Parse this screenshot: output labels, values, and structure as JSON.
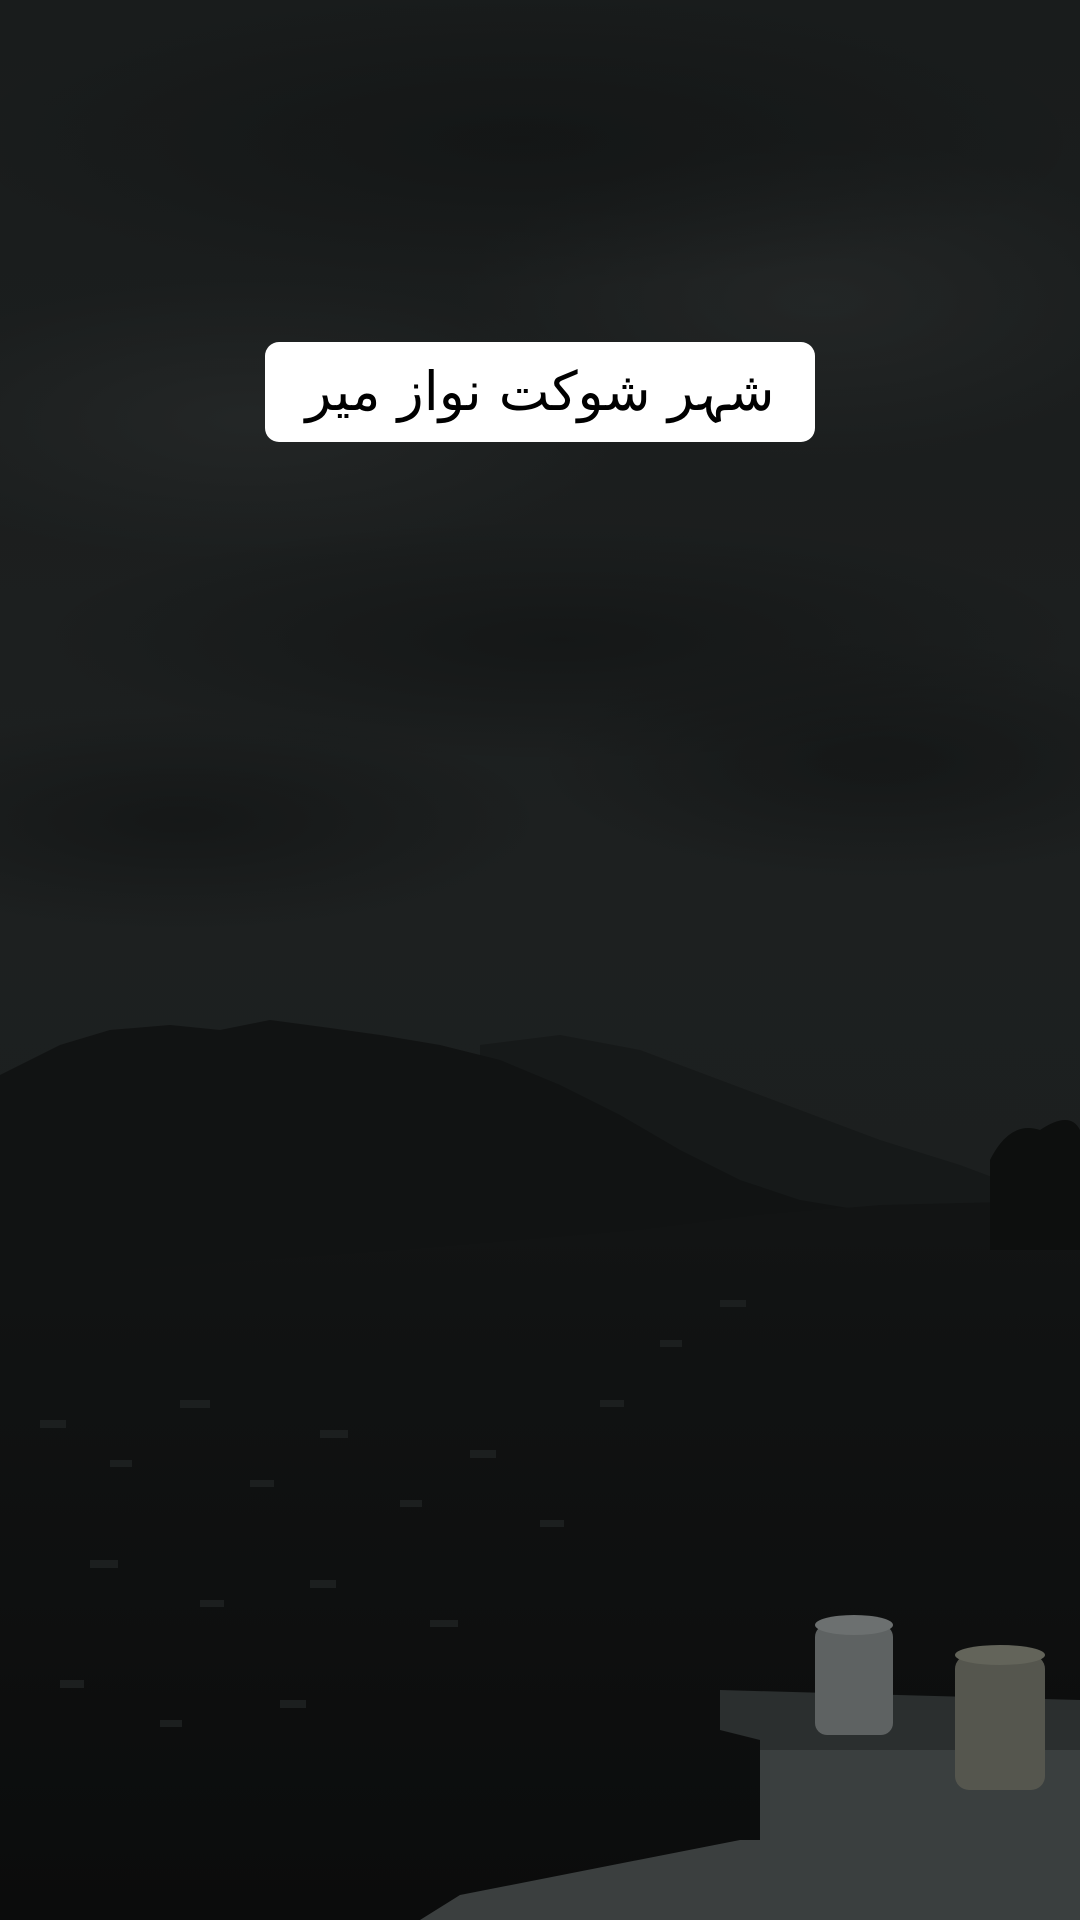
{
  "overlay": {
    "caption_text": "شہر شوکت نواز میر"
  },
  "background": {
    "scene": "dark overcast sky over mountains and a hillside town at dusk",
    "sky_color": "#1b1e1f",
    "mountain_color": "#101212",
    "town_color": "#0d0f0e"
  },
  "colors": {
    "caption_background": "#ffffff",
    "caption_text": "#000000"
  }
}
